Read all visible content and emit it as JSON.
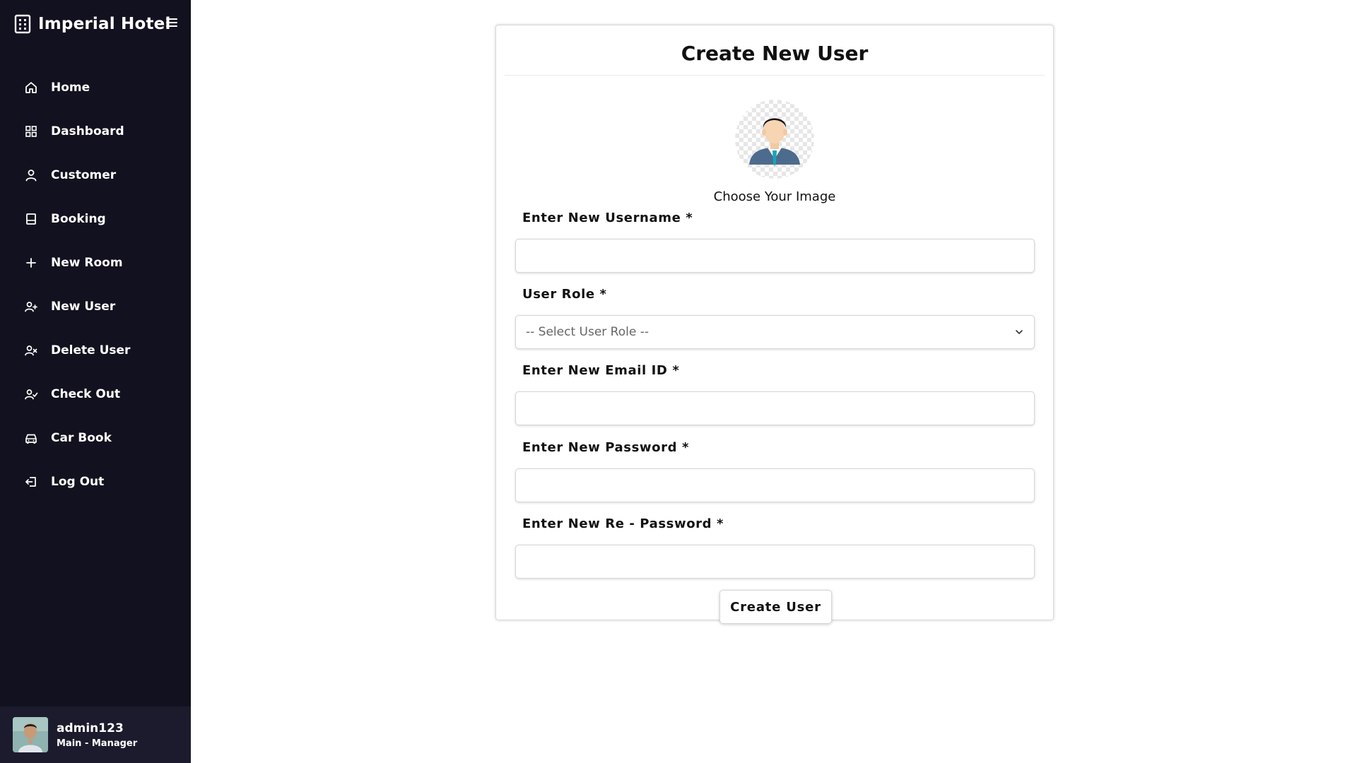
{
  "sidebar": {
    "brand": "Imperial Hotel",
    "items": [
      {
        "label": "Home",
        "icon": "home-icon"
      },
      {
        "label": "Dashboard",
        "icon": "grid-icon"
      },
      {
        "label": "Customer",
        "icon": "person-icon"
      },
      {
        "label": "Booking",
        "icon": "booking-icon"
      },
      {
        "label": "New Room",
        "icon": "plus-icon"
      },
      {
        "label": "New User",
        "icon": "user-plus-icon"
      },
      {
        "label": "Delete User",
        "icon": "user-x-icon"
      },
      {
        "label": "Check Out",
        "icon": "user-check-icon"
      },
      {
        "label": "Car Book",
        "icon": "car-icon"
      },
      {
        "label": "Log Out",
        "icon": "logout-icon"
      }
    ],
    "user": {
      "name": "admin123",
      "role": "Main - Manager"
    }
  },
  "form": {
    "title": "Create New User",
    "image_label": "Choose Your Image",
    "username_label": "Enter New Username *",
    "role_label": "User Role *",
    "role_selected": "-- Select User Role --",
    "email_label": "Enter New Email ID *",
    "password_label": "Enter New Password *",
    "repassword_label": "Enter New Re - Password *",
    "submit_label": "Create User"
  },
  "colors": {
    "sidebar_bg": "#12111f",
    "user_box_bg": "#1c1b2e",
    "card_border": "#d9d9d9"
  }
}
